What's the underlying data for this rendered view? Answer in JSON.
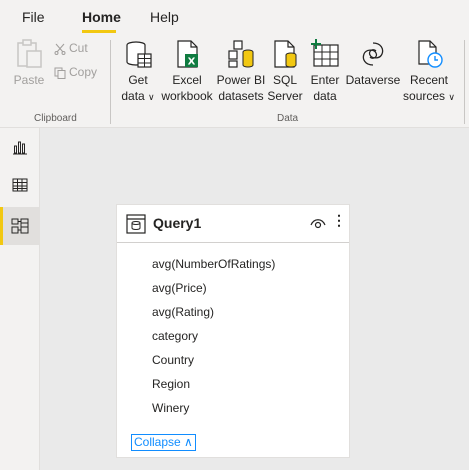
{
  "menu": {
    "tabs": [
      {
        "label": "File"
      },
      {
        "label": "Home"
      },
      {
        "label": "Help"
      }
    ]
  },
  "ribbon": {
    "clipboard": {
      "paste": "Paste",
      "cut": "Cut",
      "copy": "Copy",
      "group_label": "Clipboard"
    },
    "data": {
      "get_data": "Get",
      "get_data_2": "data",
      "excel": "Excel",
      "excel_2": "workbook",
      "pbi": "Power BI",
      "pbi_2": "datasets",
      "sql": "SQL",
      "sql_2": "Server",
      "enter": "Enter",
      "enter_2": "data",
      "dataverse": "Dataverse",
      "recent": "Recent",
      "recent_2": "sources",
      "group_label": "Data"
    },
    "chevron": "∨"
  },
  "card": {
    "title": "Query1",
    "more": "⋮",
    "fields": [
      "avg(NumberOfRatings)",
      "avg(Price)",
      "avg(Rating)",
      "category",
      "Country",
      "Region",
      "Winery"
    ],
    "collapse_label": "Collapse",
    "collapse_chevron": "∧"
  },
  "colors": {
    "accent": "#f2c811",
    "link": "#118dff",
    "excel_green": "#107c41"
  }
}
